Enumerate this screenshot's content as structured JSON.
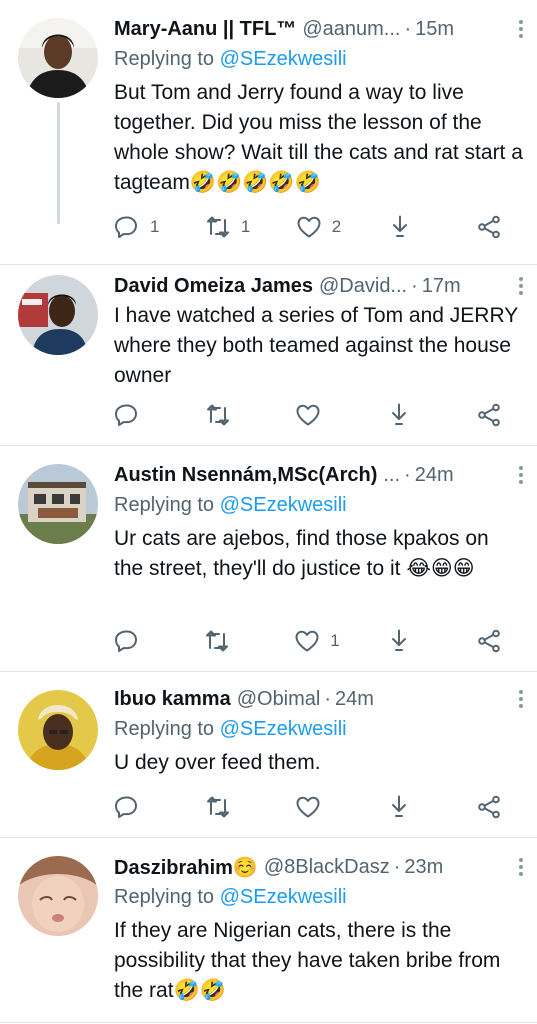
{
  "tweets": [
    {
      "name": "Mary-Aanu || TFL™",
      "handle": "@aanum...",
      "time": "15m",
      "replying_prefix": "Replying to",
      "replying_to": "@SEzekwesili",
      "text": "But Tom and Jerry found a way to live together. Did you miss the lesson of the whole show? Wait till the cats and rat start a tagteam🤣🤣🤣🤣🤣",
      "reply_count": "1",
      "retweet_count": "1",
      "like_count": "2"
    },
    {
      "name": "David Omeiza James",
      "handle": "@David...",
      "time": "17m",
      "text": "I have watched a series of Tom and JERRY where they both teamed against the house owner",
      "reply_count": "",
      "retweet_count": "",
      "like_count": ""
    },
    {
      "name": "Austin Nsennám,MSc(Arch)",
      "handle": "...",
      "time": "24m",
      "replying_prefix": "Replying to",
      "replying_to": "@SEzekwesili",
      "text": "Ur cats are ajebos, find those kpakos on the street, they'll do justice to it 😂😁😁",
      "reply_count": "",
      "retweet_count": "",
      "like_count": "1"
    },
    {
      "name": "Ibuo kamma",
      "handle": "@Obimal",
      "time": "24m",
      "replying_prefix": "Replying to",
      "replying_to": "@SEzekwesili",
      "text": "U dey over feed them.",
      "reply_count": "",
      "retweet_count": "",
      "like_count": ""
    },
    {
      "name": "Daszibrahim☺️",
      "handle": "@8BlackDasz",
      "time": "23m",
      "replying_prefix": "Replying to",
      "replying_to": "@SEzekwesili",
      "text": "If they are Nigerian cats, there is the possibility that they have taken bribe from the rat🤣🤣"
    }
  ],
  "icons": {
    "reply": "reply-icon",
    "retweet": "retweet-icon",
    "like": "like-icon",
    "bookmark": "bookmark-icon",
    "share": "share-icon",
    "more": "more-icon"
  },
  "colors": {
    "link": "#1d9bf0",
    "secondary_text": "#536471",
    "primary_text": "#0f1419",
    "separator": "#dfe4e8"
  }
}
